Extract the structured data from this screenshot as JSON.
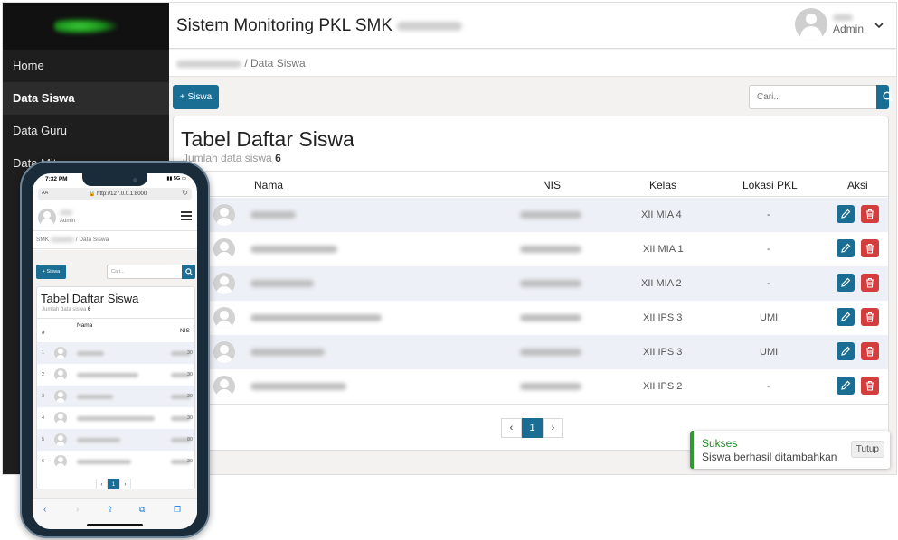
{
  "desktop": {
    "sidebar": {
      "items": [
        {
          "label": "Home"
        },
        {
          "label": "Data Siswa"
        },
        {
          "label": "Data Guru"
        },
        {
          "label": "Data Mitra"
        }
      ]
    },
    "header": {
      "title": "Sistem Monitoring PKL SMK",
      "user_role": "Admin"
    },
    "breadcrumb": {
      "current": "/ Data Siswa"
    },
    "toolbar": {
      "add_label": "+ Siswa",
      "search_placeholder": "Cari..."
    },
    "table": {
      "title": "Tabel Daftar Siswa",
      "count_label": "Jumlah data siswa",
      "count": "6",
      "columns": {
        "nama": "Nama",
        "nis": "NIS",
        "kelas": "Kelas",
        "lokasi": "Lokasi PKL",
        "aksi": "Aksi"
      },
      "rows": [
        {
          "kelas": "XII MIA 4",
          "lokasi": "-"
        },
        {
          "kelas": "XII MIA 1",
          "lokasi": "-"
        },
        {
          "kelas": "XII MIA 2",
          "lokasi": "-"
        },
        {
          "kelas": "XII IPS 3",
          "lokasi": "UMI"
        },
        {
          "kelas": "XII IPS 3",
          "lokasi": "UMI"
        },
        {
          "kelas": "XII IPS 2",
          "lokasi": "-"
        }
      ]
    },
    "pagination": {
      "prev": "‹",
      "current": "1",
      "next": "›"
    },
    "toast": {
      "title": "Sukses",
      "message": "Siswa berhasil ditambahkan",
      "close_label": "Tutup"
    }
  },
  "mobile": {
    "status": {
      "time": "7:32 PM",
      "signal": "5G"
    },
    "browser": {
      "text_size": "AA",
      "url": "http://127.0.0.1:8000"
    },
    "user_role": "Admin",
    "breadcrumb_prefix": "SMK",
    "breadcrumb": "/ Data Siswa",
    "add_label": "+ Siswa",
    "search_placeholder": "Cari...",
    "table": {
      "title": "Tabel Daftar Siswa",
      "count_label": "Jumlah data siswa",
      "count": "6",
      "col_num": "#",
      "col_nama": "Nama",
      "col_nis": "NIS",
      "rows": [
        {
          "num": "1",
          "nis_suffix": "30"
        },
        {
          "num": "2",
          "nis_suffix": "30"
        },
        {
          "num": "3",
          "nis_suffix": "30"
        },
        {
          "num": "4",
          "nis_suffix": "30"
        },
        {
          "num": "5",
          "nis_suffix": "80"
        },
        {
          "num": "6",
          "nis_suffix": "30"
        }
      ]
    },
    "pagination": {
      "prev": "‹",
      "current": "1",
      "next": "›"
    }
  },
  "colors": {
    "primary": "#1a6e93",
    "danger": "#d43d3d",
    "success": "#2d9b2d",
    "sidebar": "#1e1e1e"
  }
}
